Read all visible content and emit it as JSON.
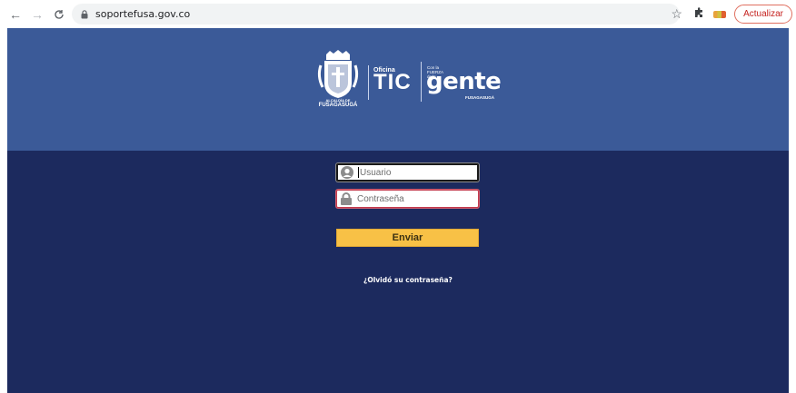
{
  "browser": {
    "url": "soportefusa.gov.co",
    "update_label": "Actualizar"
  },
  "logo": {
    "crest_caption_top": "ALCALDÍA DE",
    "crest_caption_bottom": "FUSAGASUGÁ",
    "oficina": "Oficina",
    "tic": "TIC",
    "slogan": "Con la FUERZA de la",
    "gente": "gente",
    "gente_sub": "FUSAGASUGÁ"
  },
  "login": {
    "username_placeholder": "Usuario",
    "password_placeholder": "Contraseña",
    "submit_label": "Enviar",
    "forgot_label": "¿Olvidó su contraseña?"
  },
  "colors": {
    "header_bg": "#3b5a98",
    "content_bg": "#1c2a5e",
    "button_bg": "#f8c146"
  }
}
